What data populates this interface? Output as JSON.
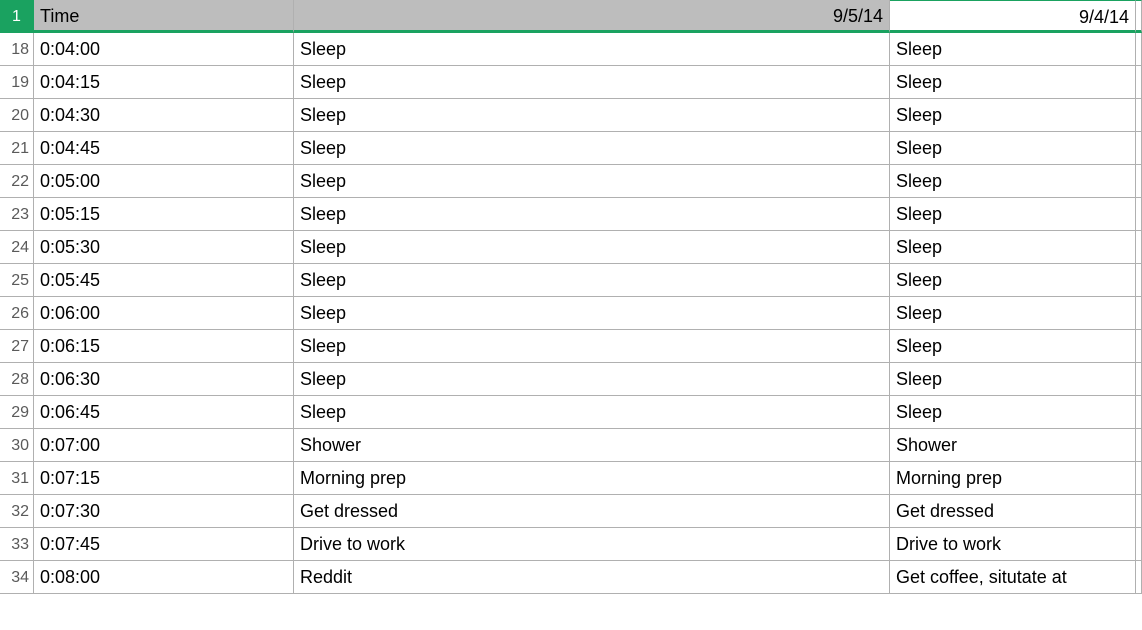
{
  "header": {
    "rownum": "1",
    "colB": "Time",
    "colC": "9/5/14",
    "colD": "9/4/14"
  },
  "rows": [
    {
      "n": "18",
      "time": "0:04:00",
      "c": "Sleep",
      "d": "Sleep"
    },
    {
      "n": "19",
      "time": "0:04:15",
      "c": "Sleep",
      "d": "Sleep"
    },
    {
      "n": "20",
      "time": "0:04:30",
      "c": "Sleep",
      "d": "Sleep"
    },
    {
      "n": "21",
      "time": "0:04:45",
      "c": "Sleep",
      "d": "Sleep"
    },
    {
      "n": "22",
      "time": "0:05:00",
      "c": "Sleep",
      "d": "Sleep"
    },
    {
      "n": "23",
      "time": "0:05:15",
      "c": "Sleep",
      "d": "Sleep"
    },
    {
      "n": "24",
      "time": "0:05:30",
      "c": "Sleep",
      "d": "Sleep"
    },
    {
      "n": "25",
      "time": "0:05:45",
      "c": "Sleep",
      "d": "Sleep"
    },
    {
      "n": "26",
      "time": "0:06:00",
      "c": "Sleep",
      "d": "Sleep"
    },
    {
      "n": "27",
      "time": "0:06:15",
      "c": "Sleep",
      "d": "Sleep"
    },
    {
      "n": "28",
      "time": "0:06:30",
      "c": "Sleep",
      "d": "Sleep"
    },
    {
      "n": "29",
      "time": "0:06:45",
      "c": "Sleep",
      "d": "Sleep"
    },
    {
      "n": "30",
      "time": "0:07:00",
      "c": "Shower",
      "d": "Shower"
    },
    {
      "n": "31",
      "time": "0:07:15",
      "c": "Morning prep",
      "d": "Morning prep"
    },
    {
      "n": "32",
      "time": "0:07:30",
      "c": "Get dressed",
      "d": "Get dressed"
    },
    {
      "n": "33",
      "time": "0:07:45",
      "c": "Drive to work",
      "d": "Drive to work"
    },
    {
      "n": "34",
      "time": "0:08:00",
      "c": "Reddit",
      "d": "Get coffee, situtate at"
    }
  ]
}
